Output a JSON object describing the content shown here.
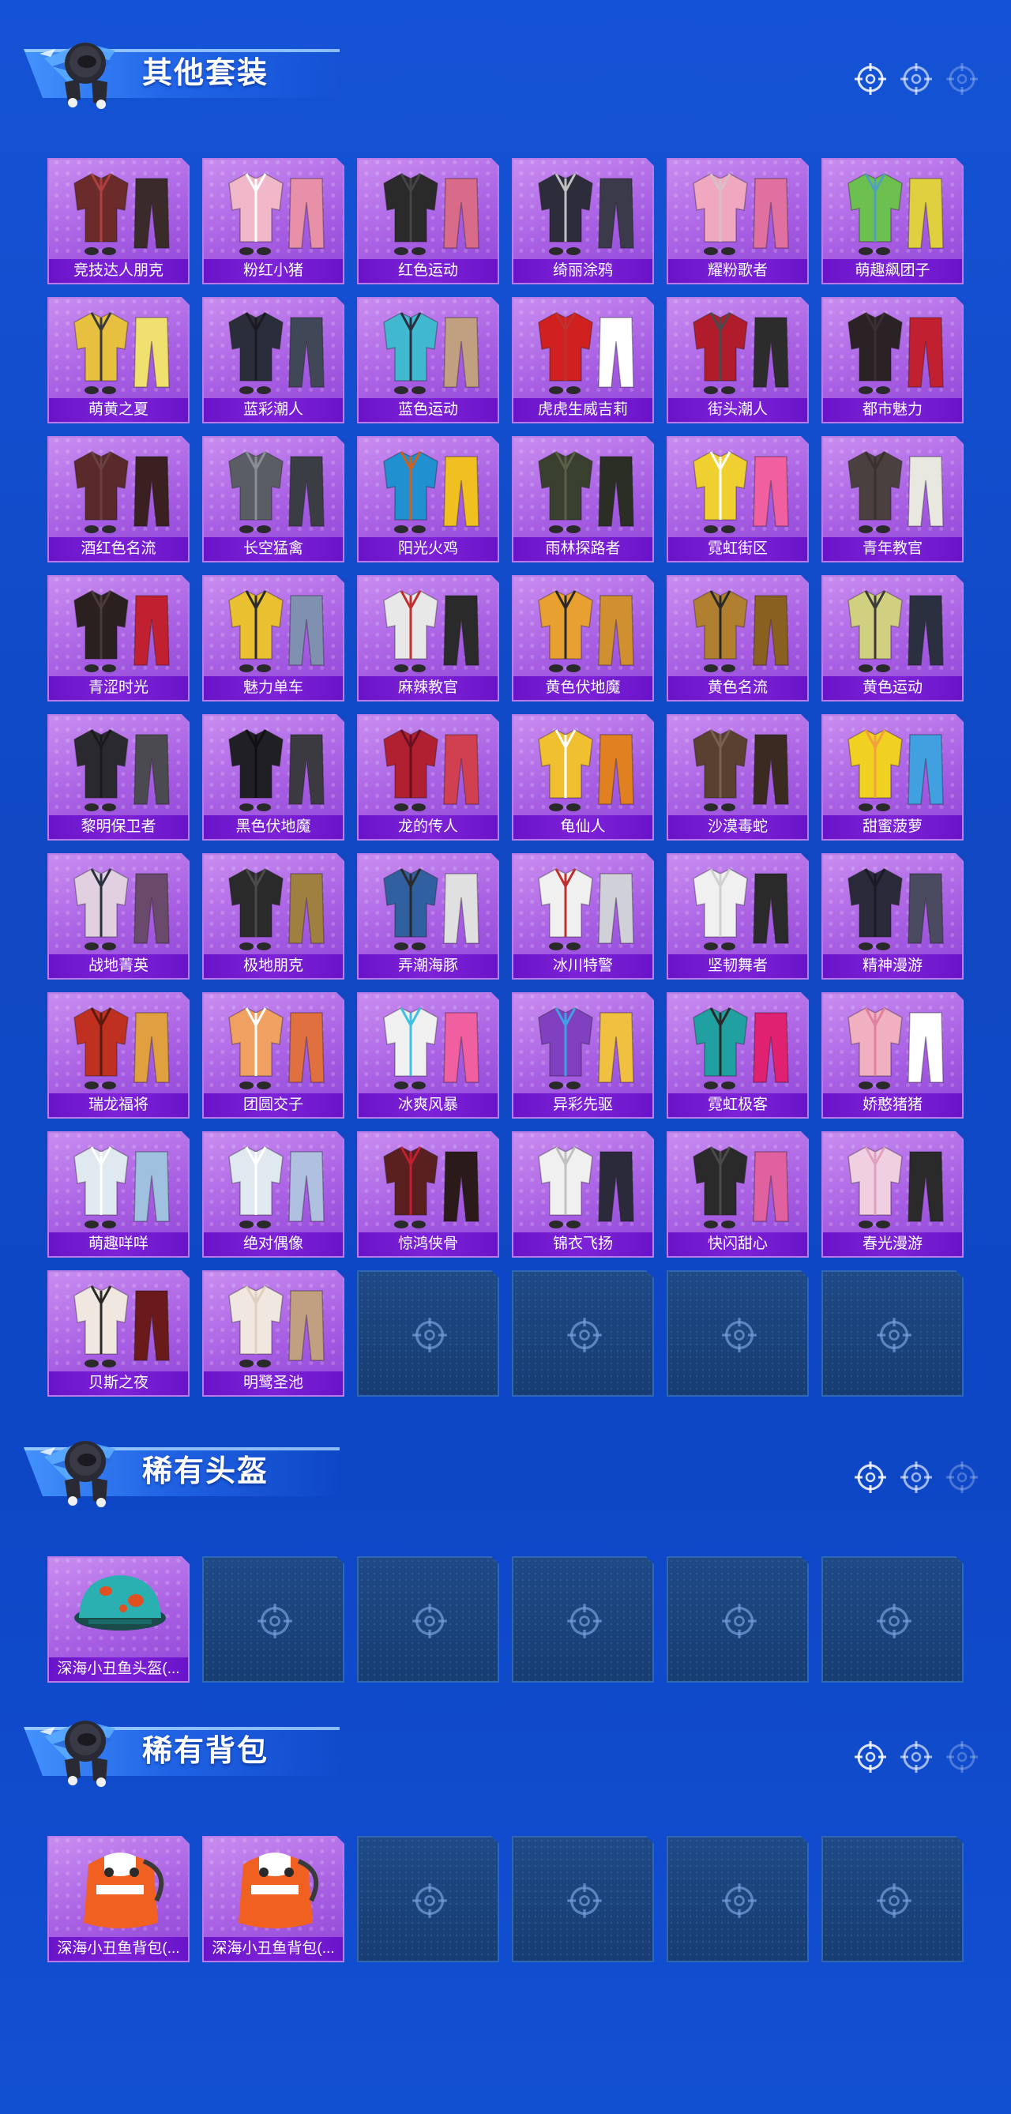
{
  "colors": {
    "background": "#1250d2",
    "card_fill": "#a85fe3",
    "card_label_bg": "#7d22d8",
    "empty_card": "#1d4680",
    "header_accent": "#4696ff"
  },
  "sections": [
    {
      "title": "其他套装",
      "icon": "mascot-icon",
      "items": [
        {
          "label": "竞技达人朋克",
          "palette": [
            "#6b2b2b",
            "#3a2a2a",
            "#b04040"
          ]
        },
        {
          "label": "粉红小猪",
          "palette": [
            "#f0b8c8",
            "#e890a8",
            "#ffffff"
          ]
        },
        {
          "label": "红色运动",
          "palette": [
            "#2a2a2a",
            "#d86a8a",
            "#444"
          ]
        },
        {
          "label": "绮丽涂鸦",
          "palette": [
            "#2c2c3a",
            "#3a3a4a",
            "#c0c0c0"
          ]
        },
        {
          "label": "耀粉歌者",
          "palette": [
            "#f0a8c0",
            "#e070a0",
            "#d8c0c8"
          ]
        },
        {
          "label": "萌趣飙团子",
          "palette": [
            "#6cc050",
            "#e0d040",
            "#50a0c0"
          ]
        },
        {
          "label": "萌黄之夏",
          "palette": [
            "#e8c040",
            "#f0e070",
            "#3a3a3a"
          ]
        },
        {
          "label": "蓝彩潮人",
          "palette": [
            "#2a2e3a",
            "#404858",
            "#1a1a20"
          ]
        },
        {
          "label": "蓝色运动",
          "palette": [
            "#40b8d0",
            "#c0a080",
            "#2a3040"
          ]
        },
        {
          "label": "虎虎生威吉莉",
          "palette": [
            "#d02020",
            "#ffffff",
            "#c03030"
          ]
        },
        {
          "label": "街头潮人",
          "palette": [
            "#b01c2c",
            "#2c2c2c",
            "#4a4a4a"
          ]
        },
        {
          "label": "都市魅力",
          "palette": [
            "#2a2224",
            "#c02030",
            "#3a3034"
          ]
        },
        {
          "label": "酒红色名流",
          "palette": [
            "#5a2a2a",
            "#3a2020",
            "#6a4040"
          ]
        },
        {
          "label": "长空猛禽",
          "palette": [
            "#5a5e64",
            "#3a3e44",
            "#8a8e94"
          ]
        },
        {
          "label": "阳光火鸡",
          "palette": [
            "#2090d0",
            "#f0c020",
            "#d06020"
          ]
        },
        {
          "label": "雨林探路者",
          "palette": [
            "#3a4030",
            "#2a2e24",
            "#5a6048"
          ]
        },
        {
          "label": "霓虹街区",
          "palette": [
            "#f0d030",
            "#f060a0",
            "#ffffff"
          ]
        },
        {
          "label": "青年教官",
          "palette": [
            "#4a4040",
            "#e8e8e0",
            "#3a3030"
          ]
        },
        {
          "label": "青涩时光",
          "palette": [
            "#2a2020",
            "#c02030",
            "#4a3a3a"
          ]
        },
        {
          "label": "魅力单车",
          "palette": [
            "#e8c030",
            "#8090b0",
            "#2a2a2a"
          ]
        },
        {
          "label": "麻辣教官",
          "palette": [
            "#e8e8e8",
            "#2a2a2a",
            "#c03030"
          ]
        },
        {
          "label": "黄色伏地魔",
          "palette": [
            "#e8a030",
            "#d09030",
            "#2a2a2a"
          ]
        },
        {
          "label": "黄色名流",
          "palette": [
            "#b08030",
            "#8a6020",
            "#2a2a2a"
          ]
        },
        {
          "label": "黄色运动",
          "palette": [
            "#d0d080",
            "#2a3040",
            "#3a3a3a"
          ]
        },
        {
          "label": "黎明保卫者",
          "palette": [
            "#2a2a2e",
            "#4a4a50",
            "#1a1a1e"
          ]
        },
        {
          "label": "黑色伏地魔",
          "palette": [
            "#202024",
            "#3a3a40",
            "#101014"
          ]
        },
        {
          "label": "龙的传人",
          "palette": [
            "#b02030",
            "#d04050",
            "#6a1020"
          ]
        },
        {
          "label": "龟仙人",
          "palette": [
            "#f0c030",
            "#e08020",
            "#ffffff"
          ]
        },
        {
          "label": "沙漠毒蛇",
          "palette": [
            "#5a4030",
            "#3a2a20",
            "#7a6050"
          ]
        },
        {
          "label": "甜蜜菠萝",
          "palette": [
            "#f0d020",
            "#40a0e0",
            "#f0a040"
          ]
        },
        {
          "label": "战地菁英",
          "palette": [
            "#e0d0e0",
            "#6a4a6a",
            "#2a3040"
          ]
        },
        {
          "label": "极地朋克",
          "palette": [
            "#2a2a2a",
            "#a08040",
            "#4a4a4a"
          ]
        },
        {
          "label": "弄潮海豚",
          "palette": [
            "#3060a0",
            "#e0e0e0",
            "#2a2a2a"
          ]
        },
        {
          "label": "冰川特警",
          "palette": [
            "#f0f0f0",
            "#d0d0d8",
            "#c03030"
          ]
        },
        {
          "label": "坚韧舞者",
          "palette": [
            "#f0f0f0",
            "#2a2a2a",
            "#d0d0d0"
          ]
        },
        {
          "label": "精神漫游",
          "palette": [
            "#2a2a3a",
            "#4a4a60",
            "#1a1a24"
          ]
        },
        {
          "label": "瑞龙福将",
          "palette": [
            "#c03020",
            "#e0a040",
            "#5a1a10"
          ]
        },
        {
          "label": "团圆交子",
          "palette": [
            "#f0a060",
            "#e07040",
            "#ffffff"
          ]
        },
        {
          "label": "冰爽风暴",
          "palette": [
            "#f0f0f0",
            "#f060a0",
            "#40c0e0"
          ]
        },
        {
          "label": "异彩先驱",
          "palette": [
            "#8040c0",
            "#f0c040",
            "#40a0e0"
          ]
        },
        {
          "label": "霓虹极客",
          "palette": [
            "#20a0a0",
            "#e02070",
            "#2a2a2a"
          ]
        },
        {
          "label": "娇憨猪猪",
          "palette": [
            "#f0b0c0",
            "#ffffff",
            "#e080a0"
          ]
        },
        {
          "label": "萌趣咩咩",
          "palette": [
            "#e0e8f0",
            "#a0c0e0",
            "#ffffff"
          ]
        },
        {
          "label": "绝对偶像",
          "palette": [
            "#e0e8f0",
            "#b0c0e0",
            "#ffffff"
          ]
        },
        {
          "label": "惊鸿侠骨",
          "palette": [
            "#5a2020",
            "#2a1a1a",
            "#c02030"
          ]
        },
        {
          "label": "锦衣飞扬",
          "palette": [
            "#f0f0f0",
            "#2a2a3a",
            "#c0c0c0"
          ]
        },
        {
          "label": "快闪甜心",
          "palette": [
            "#2a2a2a",
            "#e060a0",
            "#4a4a4a"
          ]
        },
        {
          "label": "春光漫游",
          "palette": [
            "#f0d0e0",
            "#2a2a2a",
            "#e0a0c0"
          ]
        },
        {
          "label": "贝斯之夜",
          "palette": [
            "#f0e8e0",
            "#6a1a1a",
            "#2a2a2a"
          ]
        },
        {
          "label": "明鹭圣池",
          "palette": [
            "#f0e8e0",
            "#c0a080",
            "#e0d0c0"
          ]
        }
      ],
      "empty_slots": 4
    },
    {
      "title": "稀有头盔",
      "icon": "mascot-icon",
      "items": [
        {
          "label": "深海小丑鱼头盔(...",
          "palette": [
            "#2ab0b0",
            "#e05020",
            "#1a6a6a"
          ],
          "kind": "helmet"
        }
      ],
      "empty_slots": 5
    },
    {
      "title": "稀有背包",
      "icon": "mascot-icon",
      "items": [
        {
          "label": "深海小丑鱼背包(...",
          "palette": [
            "#f06020",
            "#ffffff",
            "#2a2a2a"
          ],
          "kind": "backpack"
        },
        {
          "label": "深海小丑鱼背包(...",
          "palette": [
            "#f06020",
            "#ffffff",
            "#2a2a2a"
          ],
          "kind": "backpack"
        }
      ],
      "empty_slots": 4
    }
  ]
}
